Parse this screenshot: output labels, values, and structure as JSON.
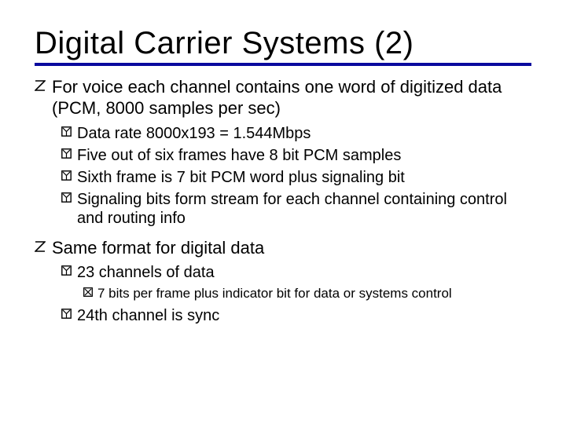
{
  "title": "Digital Carrier Systems (2)",
  "items": [
    {
      "level": 1,
      "text": "For voice each channel contains one word of digitized data (PCM, 8000 samples per sec)"
    },
    {
      "level": 2,
      "text": "Data rate 8000x193 = 1.544Mbps"
    },
    {
      "level": 2,
      "text": "Five out of six frames have 8 bit PCM samples"
    },
    {
      "level": 2,
      "text": "Sixth frame is 7 bit PCM word plus signaling bit"
    },
    {
      "level": 2,
      "text": "Signaling bits form stream for each channel containing control and routing info"
    },
    {
      "level": 1,
      "text": "Same format for digital data"
    },
    {
      "level": 2,
      "text": "23 channels of data"
    },
    {
      "level": 3,
      "text": "7 bits per frame plus indicator bit for data or systems control"
    },
    {
      "level": 2,
      "text": "24th channel is sync"
    }
  ]
}
